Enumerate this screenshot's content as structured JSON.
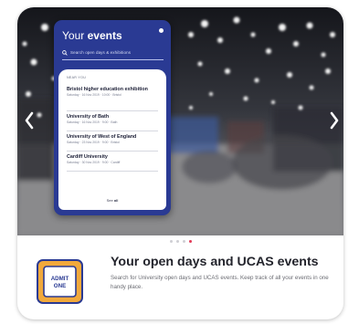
{
  "preview": {
    "title_prefix": "Your",
    "title_bold": "events",
    "search_placeholder": "Search open days & exhibitions",
    "section_label": "NEAR YOU",
    "events": [
      {
        "name": "Bristol higher education exhibition",
        "date": "Saturday · 16 Nov 2019 · 10:00 · Bristol"
      },
      {
        "name": "University of Bath",
        "date": "Saturday · 16 Nov 2019 · 9:00 · Bath"
      },
      {
        "name": "University of West of England",
        "date": "Saturday · 23 Nov 2019 · 9:00 · Bristol"
      },
      {
        "name": "Cardiff University",
        "date": "Saturday · 30 Nov 2019 · 9:00 · Cardiff"
      }
    ],
    "see_all_prefix": "See",
    "see_all_bold": "all"
  },
  "ticket": {
    "line1": "ADMIT",
    "line2": "ONE"
  },
  "feature": {
    "headline": "Your open days and UCAS events",
    "description": "Search for University open days and UCAS events. Keep track of all your events in one handy place."
  },
  "carousel": {
    "slide_count": 4,
    "active_index": 3
  },
  "colors": {
    "brand_navy": "#2a3a93",
    "accent_pink": "#e23b57",
    "ticket_orange": "#f2a93b"
  }
}
